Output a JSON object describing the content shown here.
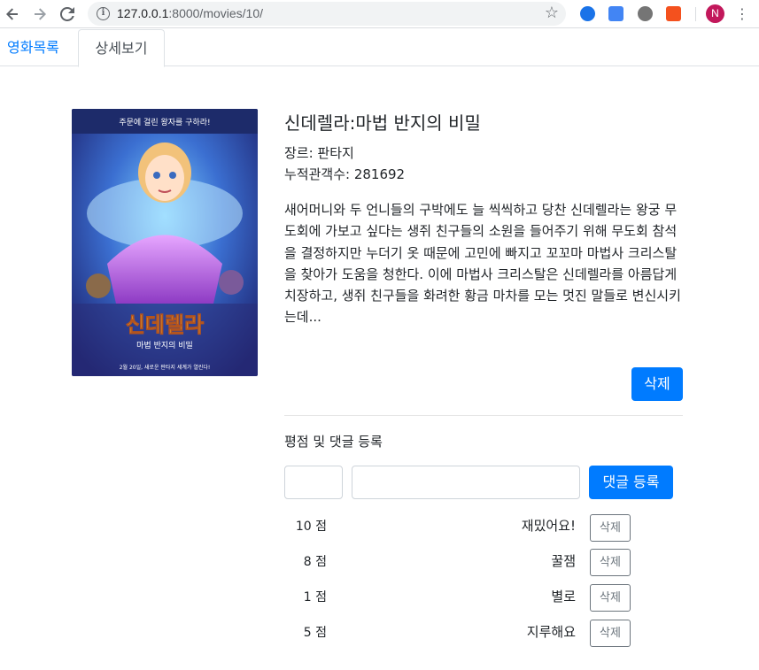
{
  "browser": {
    "url_host": "127.0.0.1",
    "url_path": ":8000/movies/10/",
    "profile_initial": "N"
  },
  "tabs": [
    {
      "label": "영화목록",
      "active": false
    },
    {
      "label": "상세보기",
      "active": true
    }
  ],
  "movie": {
    "title": "신데렐라:마법 반지의 비밀",
    "genre": "장르: 판타지",
    "audience": "누적관객수: 281692",
    "description": "새어머니와 두 언니들의 구박에도 늘 씩씩하고 당찬 신데렐라는 왕궁 무도회에 가보고 싶다는 생쥐 친구들의 소원을 들어주기 위해 무도회 참석을 결정하지만 누더기 옷 때문에 고민에 빠지고 꼬꼬마 마법사 크리스탈을 찾아가 도움을 청한다. 이에 마법사 크리스탈은 신데렐라를 아름답게 치장하고, 생쥐 친구들을 화려한 황금 마차를 모는 멋진 말들로 변신시키는데...",
    "poster": {
      "tagline": "주문에 걸린 왕자를 구하라!",
      "title_art": "신데렐라",
      "subtitle_art": "마법 반지의 비밀",
      "footer": "2월 20일, 새로운 판타지 세계가 열린다!"
    },
    "delete_label": "삭제"
  },
  "review_form": {
    "section_title": "평점 및 댓글 등록",
    "score_value": "",
    "comment_value": "",
    "submit_label": "댓글 등록"
  },
  "reviews": [
    {
      "score": "10 점",
      "comment": "재밌어요!",
      "delete_label": "삭제"
    },
    {
      "score": "8 점",
      "comment": "꿀잼",
      "delete_label": "삭제"
    },
    {
      "score": "1 점",
      "comment": "별로",
      "delete_label": "삭제"
    },
    {
      "score": "5 점",
      "comment": "지루해요",
      "delete_label": "삭제"
    }
  ],
  "colors": {
    "primary": "#007bff",
    "secondary": "#6c757d"
  }
}
